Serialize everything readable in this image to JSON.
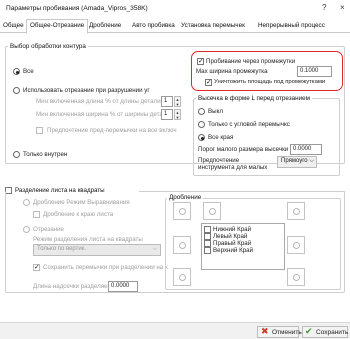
{
  "window": {
    "title": "Параметры пробивания (Amada_Vipros_358K)",
    "help": "?",
    "close": "×"
  },
  "tabs": [
    {
      "label": "Общее"
    },
    {
      "label": "Общее-Отрезание"
    },
    {
      "label": "Дробление"
    },
    {
      "label": "Авто пробивка"
    },
    {
      "label": "Установка перемычек"
    },
    {
      "label": "Непрерывный процесс"
    }
  ],
  "cutting_choice": {
    "legend": "Выбор обработки контура",
    "all": "Все",
    "use_breaking": "Использовать отрезание при разрушении уг",
    "min_len_label": "Мин включенная длина % от длины детали",
    "min_len_value": "1",
    "min_width_label": "Мин включенная ширина % от ширины детал",
    "min_width_value": "1",
    "pref_jumpers": "Предпочтение пред-перемычки на все включ",
    "only_inside": "Только внутрен"
  },
  "gaps": {
    "punch_gaps": "Пробивание через промежутки",
    "max_width_label": "Max ширина промежутка",
    "max_width_value": "0.1000",
    "destroy_area": "Уничтожить площадь под промежутками"
  },
  "cutout_shape": {
    "legend": "Высечка в форме L перед отрезанием",
    "off": "Выкл",
    "corner_only": "Только с угловой перемычкс",
    "all_edges": "Все края",
    "threshold_label": "Порог малого размера высечки",
    "threshold_value": "0.0000",
    "preferred_label_1": "Предпочтение",
    "preferred_label_2": "инструмента для малых",
    "preferred_value": "Прямоуго"
  },
  "split": {
    "legend": "Разделение листа на квадраты",
    "split_mode": "Дробление Режим Выравнивания",
    "split_edge": "Дробление к краю листа",
    "cutting": "Отрезание",
    "mode_label": "Режим разделения листа на квадраты",
    "mode_value": "Только по вертик.",
    "keep_jumpers": "Сохранить перемычки при разделении на к",
    "notch_label": "Длина надсечки разделяемого w",
    "notch_value": "0.0000",
    "splitting_legend": "Дробление"
  },
  "edges": [
    {
      "label": "Нижний Край"
    },
    {
      "label": "Левый Край"
    },
    {
      "label": "Правый Край"
    },
    {
      "label": "Верхний Край"
    }
  ],
  "footer": {
    "cancel": "Отменить",
    "save": "Сохранить"
  },
  "colors": {
    "highlight": "#e0292c",
    "cancel_icon": "#d23a24",
    "save_icon": "#3a9a2e"
  }
}
